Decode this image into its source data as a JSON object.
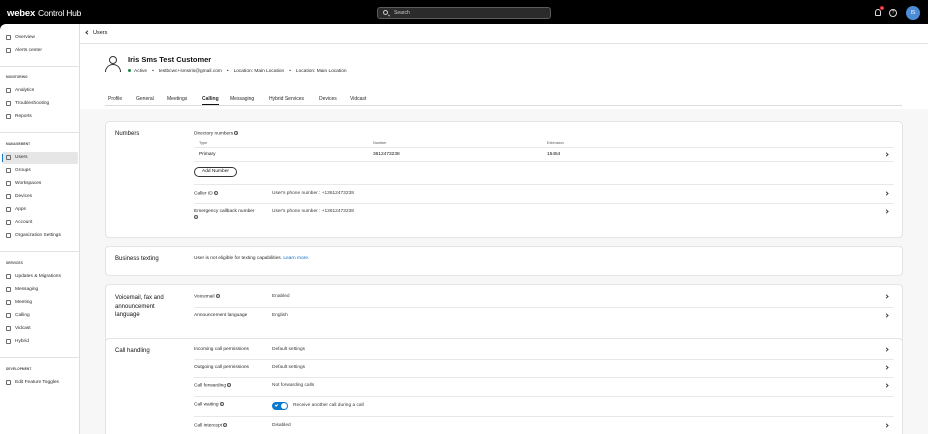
{
  "topbar": {
    "logo": "webex",
    "product": "Control Hub",
    "search_placeholder": "Search",
    "notification_count": "1",
    "avatar_initials": "IS"
  },
  "sidebar": {
    "top_items": [
      {
        "label": "Overview",
        "icon": "home-icon"
      },
      {
        "label": "Alerts center",
        "icon": "bell-icon"
      }
    ],
    "monitoring_label": "MONITORING",
    "monitoring_items": [
      {
        "label": "Analytics",
        "icon": "analytics-icon"
      },
      {
        "label": "Troubleshooting",
        "icon": "pulse-icon"
      },
      {
        "label": "Reports",
        "icon": "report-icon"
      }
    ],
    "management_label": "MANAGEMENT",
    "management_items": [
      {
        "label": "Users",
        "icon": "user-icon",
        "active": true
      },
      {
        "label": "Groups",
        "icon": "group-icon"
      },
      {
        "label": "Workspaces",
        "icon": "workspace-icon"
      },
      {
        "label": "Devices",
        "icon": "device-icon"
      },
      {
        "label": "Apps",
        "icon": "apps-icon"
      },
      {
        "label": "Account",
        "icon": "account-icon"
      },
      {
        "label": "Organization Settings",
        "icon": "settings-icon"
      }
    ],
    "services_label": "SERVICES",
    "services_items": [
      {
        "label": "Updates & Migrations",
        "icon": "refresh-icon"
      },
      {
        "label": "Messaging",
        "icon": "chat-icon"
      },
      {
        "label": "Meeting",
        "icon": "meeting-icon"
      },
      {
        "label": "Calling",
        "icon": "phone-icon"
      },
      {
        "label": "Vidcast",
        "icon": "vidcast-icon"
      },
      {
        "label": "Hybrid",
        "icon": "hybrid-icon"
      }
    ],
    "development_label": "DEVELOPMENT",
    "development_items": [
      {
        "label": "Edit Feature Toggles",
        "icon": "toggle-icon"
      }
    ]
  },
  "header": {
    "back_label": "Users",
    "user_name": "Iris Sms Test Customer",
    "status": "Active",
    "email": "testbcwc+smsiris@gmail.com",
    "location1": "Location: Main Location",
    "location2": "Location: Main Location",
    "tabs": [
      "Profile",
      "General",
      "Meetings",
      "Calling",
      "Messaging",
      "Hybrid Services",
      "Devices",
      "Vidcast"
    ],
    "active_tab": "Calling"
  },
  "numbers": {
    "title": "Numbers",
    "directory_label": "Directory numbers",
    "col_type": "Type",
    "col_number": "Number",
    "col_extension": "Extension",
    "row_type": "Primary",
    "row_number": "3612473238",
    "row_extension": "15454",
    "add_button": "Add Number",
    "caller_id_label": "Caller ID",
    "caller_id_value": "User's phone number : +13612473238",
    "emergency_label": "Emergency callback number",
    "emergency_value": "User's phone number : +13612473238"
  },
  "texting": {
    "title": "Business texting",
    "message": "User is not eligible for texting capabilities.",
    "link": "Learn more."
  },
  "voicemail": {
    "title": "Voicemail, fax and announcement language",
    "voicemail_label": "Voicemail",
    "voicemail_value": "Enabled",
    "announcement_label": "Announcement language",
    "announcement_value": "English"
  },
  "call_handling": {
    "title": "Call handling",
    "incoming_label": "Incoming call permissions",
    "incoming_value": "Default settings",
    "outgoing_label": "Outgoing call permissions",
    "outgoing_value": "Default settings",
    "forwarding_label": "Call forwarding",
    "forwarding_value": "Not forwarding calls",
    "waiting_label": "Call waiting",
    "waiting_value": "Receive another call during a call",
    "intercept_label": "Call intercept",
    "intercept_value": "Disabled"
  }
}
